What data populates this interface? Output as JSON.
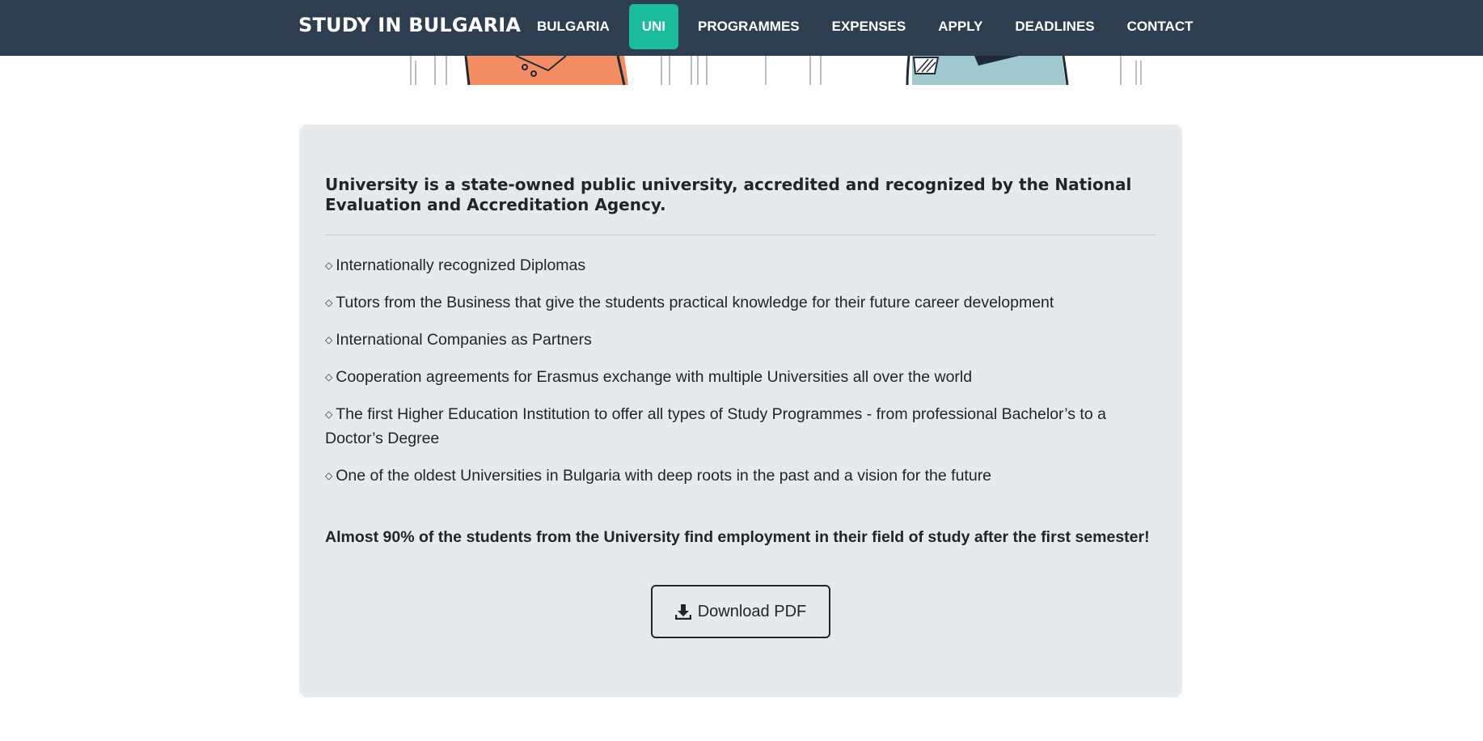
{
  "navbar": {
    "brand": "STUDY IN BULGARIA",
    "items": [
      {
        "label": "BULGARIA",
        "active": false
      },
      {
        "label": "UNI",
        "active": true
      },
      {
        "label": "PROGRAMMES",
        "active": false
      },
      {
        "label": "EXPENSES",
        "active": false
      },
      {
        "label": "APPLY",
        "active": false
      },
      {
        "label": "DEADLINES",
        "active": false
      },
      {
        "label": "CONTACT",
        "active": false
      }
    ]
  },
  "hero": {
    "icon": "illustration-people-bars"
  },
  "card": {
    "headline": "University is a state-owned public university, accredited and recognized by the National Evaluation and Accreditation Agency.",
    "bullet_symbol": "◇",
    "features": [
      "Internationally recognized Diplomas",
      "Tutors from the Business that give the students practical knowledge for their future career development",
      "International Companies as Partners",
      "Cooperation agreements for Erasmus exchange with multiple Universities all over the world",
      "The first Higher Education Institution to offer all types of Study Programmes - from professional Bachelor’s to a Doctor’s Degree",
      "One of the oldest Universities in Bulgaria with deep roots in the past and a vision for the future"
    ],
    "highlight": "Almost 90% of the students from the University find employment in their field of study after the first semester!",
    "download_label": "Download PDF",
    "download_icon": "download-icon"
  },
  "colors": {
    "navbar_bg": "#2c3e50",
    "active_tab": "#1abc9c",
    "card_bg": "#e7eaed",
    "orange": "#f48c64",
    "teal": "#a0c8cf"
  }
}
